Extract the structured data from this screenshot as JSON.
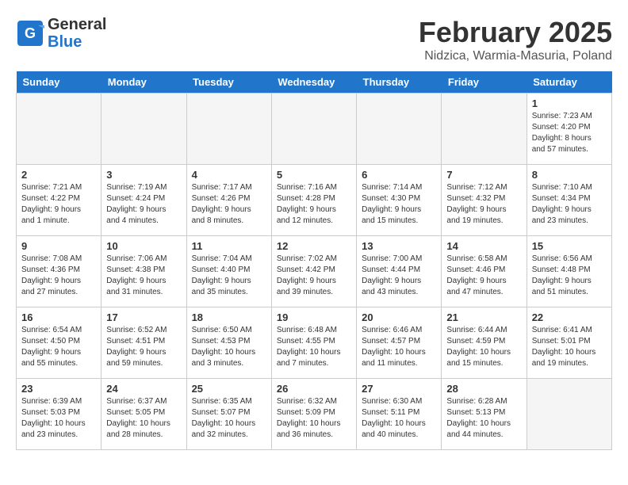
{
  "header": {
    "logo_line1": "General",
    "logo_line2": "Blue",
    "title": "February 2025",
    "subtitle": "Nidzica, Warmia-Masuria, Poland"
  },
  "days_of_week": [
    "Sunday",
    "Monday",
    "Tuesday",
    "Wednesday",
    "Thursday",
    "Friday",
    "Saturday"
  ],
  "weeks": [
    [
      {
        "day": "",
        "empty": true
      },
      {
        "day": "",
        "empty": true
      },
      {
        "day": "",
        "empty": true
      },
      {
        "day": "",
        "empty": true
      },
      {
        "day": "",
        "empty": true
      },
      {
        "day": "",
        "empty": true
      },
      {
        "day": "1",
        "info": "Sunrise: 7:23 AM\nSunset: 4:20 PM\nDaylight: 8 hours\nand 57 minutes."
      }
    ],
    [
      {
        "day": "2",
        "info": "Sunrise: 7:21 AM\nSunset: 4:22 PM\nDaylight: 9 hours\nand 1 minute."
      },
      {
        "day": "3",
        "info": "Sunrise: 7:19 AM\nSunset: 4:24 PM\nDaylight: 9 hours\nand 4 minutes."
      },
      {
        "day": "4",
        "info": "Sunrise: 7:17 AM\nSunset: 4:26 PM\nDaylight: 9 hours\nand 8 minutes."
      },
      {
        "day": "5",
        "info": "Sunrise: 7:16 AM\nSunset: 4:28 PM\nDaylight: 9 hours\nand 12 minutes."
      },
      {
        "day": "6",
        "info": "Sunrise: 7:14 AM\nSunset: 4:30 PM\nDaylight: 9 hours\nand 15 minutes."
      },
      {
        "day": "7",
        "info": "Sunrise: 7:12 AM\nSunset: 4:32 PM\nDaylight: 9 hours\nand 19 minutes."
      },
      {
        "day": "8",
        "info": "Sunrise: 7:10 AM\nSunset: 4:34 PM\nDaylight: 9 hours\nand 23 minutes."
      }
    ],
    [
      {
        "day": "9",
        "info": "Sunrise: 7:08 AM\nSunset: 4:36 PM\nDaylight: 9 hours\nand 27 minutes."
      },
      {
        "day": "10",
        "info": "Sunrise: 7:06 AM\nSunset: 4:38 PM\nDaylight: 9 hours\nand 31 minutes."
      },
      {
        "day": "11",
        "info": "Sunrise: 7:04 AM\nSunset: 4:40 PM\nDaylight: 9 hours\nand 35 minutes."
      },
      {
        "day": "12",
        "info": "Sunrise: 7:02 AM\nSunset: 4:42 PM\nDaylight: 9 hours\nand 39 minutes."
      },
      {
        "day": "13",
        "info": "Sunrise: 7:00 AM\nSunset: 4:44 PM\nDaylight: 9 hours\nand 43 minutes."
      },
      {
        "day": "14",
        "info": "Sunrise: 6:58 AM\nSunset: 4:46 PM\nDaylight: 9 hours\nand 47 minutes."
      },
      {
        "day": "15",
        "info": "Sunrise: 6:56 AM\nSunset: 4:48 PM\nDaylight: 9 hours\nand 51 minutes."
      }
    ],
    [
      {
        "day": "16",
        "info": "Sunrise: 6:54 AM\nSunset: 4:50 PM\nDaylight: 9 hours\nand 55 minutes."
      },
      {
        "day": "17",
        "info": "Sunrise: 6:52 AM\nSunset: 4:51 PM\nDaylight: 9 hours\nand 59 minutes."
      },
      {
        "day": "18",
        "info": "Sunrise: 6:50 AM\nSunset: 4:53 PM\nDaylight: 10 hours\nand 3 minutes."
      },
      {
        "day": "19",
        "info": "Sunrise: 6:48 AM\nSunset: 4:55 PM\nDaylight: 10 hours\nand 7 minutes."
      },
      {
        "day": "20",
        "info": "Sunrise: 6:46 AM\nSunset: 4:57 PM\nDaylight: 10 hours\nand 11 minutes."
      },
      {
        "day": "21",
        "info": "Sunrise: 6:44 AM\nSunset: 4:59 PM\nDaylight: 10 hours\nand 15 minutes."
      },
      {
        "day": "22",
        "info": "Sunrise: 6:41 AM\nSunset: 5:01 PM\nDaylight: 10 hours\nand 19 minutes."
      }
    ],
    [
      {
        "day": "23",
        "info": "Sunrise: 6:39 AM\nSunset: 5:03 PM\nDaylight: 10 hours\nand 23 minutes."
      },
      {
        "day": "24",
        "info": "Sunrise: 6:37 AM\nSunset: 5:05 PM\nDaylight: 10 hours\nand 28 minutes."
      },
      {
        "day": "25",
        "info": "Sunrise: 6:35 AM\nSunset: 5:07 PM\nDaylight: 10 hours\nand 32 minutes."
      },
      {
        "day": "26",
        "info": "Sunrise: 6:32 AM\nSunset: 5:09 PM\nDaylight: 10 hours\nand 36 minutes."
      },
      {
        "day": "27",
        "info": "Sunrise: 6:30 AM\nSunset: 5:11 PM\nDaylight: 10 hours\nand 40 minutes."
      },
      {
        "day": "28",
        "info": "Sunrise: 6:28 AM\nSunset: 5:13 PM\nDaylight: 10 hours\nand 44 minutes."
      },
      {
        "day": "",
        "empty": true
      }
    ]
  ]
}
